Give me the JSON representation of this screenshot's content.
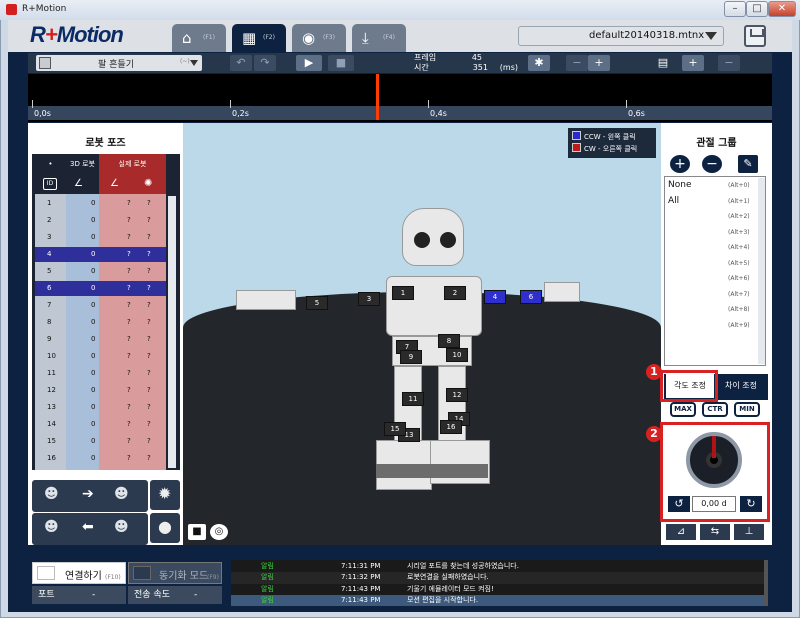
{
  "window": {
    "title": "R+Motion",
    "min": "–",
    "max": "□",
    "close": "✕"
  },
  "app": {
    "logo_r": "R",
    "logo_plus": "+",
    "logo_motion": "Motion"
  },
  "tabs": [
    {
      "icon": "⌂",
      "key": "(F1)",
      "name": "home"
    },
    {
      "icon": "▦",
      "key": "(F2)",
      "name": "motion"
    },
    {
      "icon": "◉",
      "key": "(F3)",
      "name": "media"
    },
    {
      "icon": "⤓",
      "key": "(F4)",
      "name": "download"
    }
  ],
  "file": {
    "name": "default20140318.mtnx"
  },
  "toolbar": {
    "mode_label": "팔 흔들기",
    "mode_key": "(~)",
    "undo": "↶",
    "redo": "↷",
    "play": "▶",
    "stop": "■",
    "frame_label": "프레임",
    "frame_value": "45",
    "time_label": "시간",
    "time_value": "351",
    "time_unit": "(ms)",
    "settings": "✱",
    "zoom_out": "−",
    "zoom_in": "+",
    "scene": "▤",
    "add": "+",
    "remove": "−"
  },
  "timeline": {
    "ticks": [
      "0,0s",
      "0,2s",
      "0,4s",
      "0,6s"
    ]
  },
  "robot_pose": {
    "title": "로봇 포즈",
    "col_dot": "•",
    "col_3d": "3D 로봇",
    "col_real": "실제 로봇",
    "id_icon": "ID",
    "rows": [
      {
        "id": "1",
        "v3d": "0",
        "r1": "?",
        "r2": "?"
      },
      {
        "id": "2",
        "v3d": "0",
        "r1": "?",
        "r2": "?"
      },
      {
        "id": "3",
        "v3d": "0",
        "r1": "?",
        "r2": "?"
      },
      {
        "id": "4",
        "v3d": "0",
        "r1": "?",
        "r2": "?"
      },
      {
        "id": "5",
        "v3d": "0",
        "r1": "?",
        "r2": "?"
      },
      {
        "id": "6",
        "v3d": "0",
        "r1": "?",
        "r2": "?"
      },
      {
        "id": "7",
        "v3d": "0",
        "r1": "?",
        "r2": "?"
      },
      {
        "id": "8",
        "v3d": "0",
        "r1": "?",
        "r2": "?"
      },
      {
        "id": "9",
        "v3d": "0",
        "r1": "?",
        "r2": "?"
      },
      {
        "id": "10",
        "v3d": "0",
        "r1": "?",
        "r2": "?"
      },
      {
        "id": "11",
        "v3d": "0",
        "r1": "?",
        "r2": "?"
      },
      {
        "id": "12",
        "v3d": "0",
        "r1": "?",
        "r2": "?"
      },
      {
        "id": "13",
        "v3d": "0",
        "r1": "?",
        "r2": "?"
      },
      {
        "id": "14",
        "v3d": "0",
        "r1": "?",
        "r2": "?"
      },
      {
        "id": "15",
        "v3d": "0",
        "r1": "?",
        "r2": "?"
      },
      {
        "id": "16",
        "v3d": "0",
        "r1": "?",
        "r2": "?"
      }
    ]
  },
  "legend": {
    "ccw": "CCW - 왼쪽 클릭",
    "cw": "CW  - 오른쪽 클릭",
    "ccw_color": "#2a2ad0",
    "cw_color": "#c01b1b"
  },
  "robot_labels": [
    "1",
    "2",
    "3",
    "4",
    "5",
    "6",
    "7",
    "8",
    "9",
    "10",
    "11",
    "12",
    "13",
    "14",
    "15",
    "16"
  ],
  "joint_group": {
    "title": "관절 그룹",
    "items": [
      {
        "name": "None",
        "key": "(Alt+0)"
      },
      {
        "name": "All",
        "key": "(Alt+1)"
      },
      {
        "name": "",
        "key": "(Alt+2)"
      },
      {
        "name": "",
        "key": "(Alt+3)"
      },
      {
        "name": "",
        "key": "(Alt+4)"
      },
      {
        "name": "",
        "key": "(Alt+5)"
      },
      {
        "name": "",
        "key": "(Alt+6)"
      },
      {
        "name": "",
        "key": "(Alt+7)"
      },
      {
        "name": "",
        "key": "(Alt+8)"
      },
      {
        "name": "",
        "key": "(Alt+9)"
      }
    ]
  },
  "adjust": {
    "tab_angle": "각도 조정",
    "tab_diff": "차이 조정",
    "max": "MAX",
    "ctr": "CTR",
    "min": "MIN",
    "angle_value": "0,00 d",
    "badge1": "1",
    "badge2": "2"
  },
  "bottom": {
    "connect": "연결하기",
    "connect_key": "(F10)",
    "sync": "동기화 모드",
    "sync_key": "(F9)",
    "port_label": "포트",
    "port_value": "-",
    "speed_label": "전송 속도",
    "speed_value": "-",
    "log": [
      {
        "type": "알림",
        "time": "7:11:31 PM",
        "msg": "시리얼 포트를 찾는데 성공하였습니다."
      },
      {
        "type": "알림",
        "time": "7:11:32 PM",
        "msg": "로봇연결을 실패하였습니다."
      },
      {
        "type": "알림",
        "time": "7:11:43 PM",
        "msg": "기울기 에뮬레이터 모드 켜짐!"
      },
      {
        "type": "알림",
        "time": "7:11:43 PM",
        "msg": "모션 편집을 시작합니다."
      }
    ]
  }
}
